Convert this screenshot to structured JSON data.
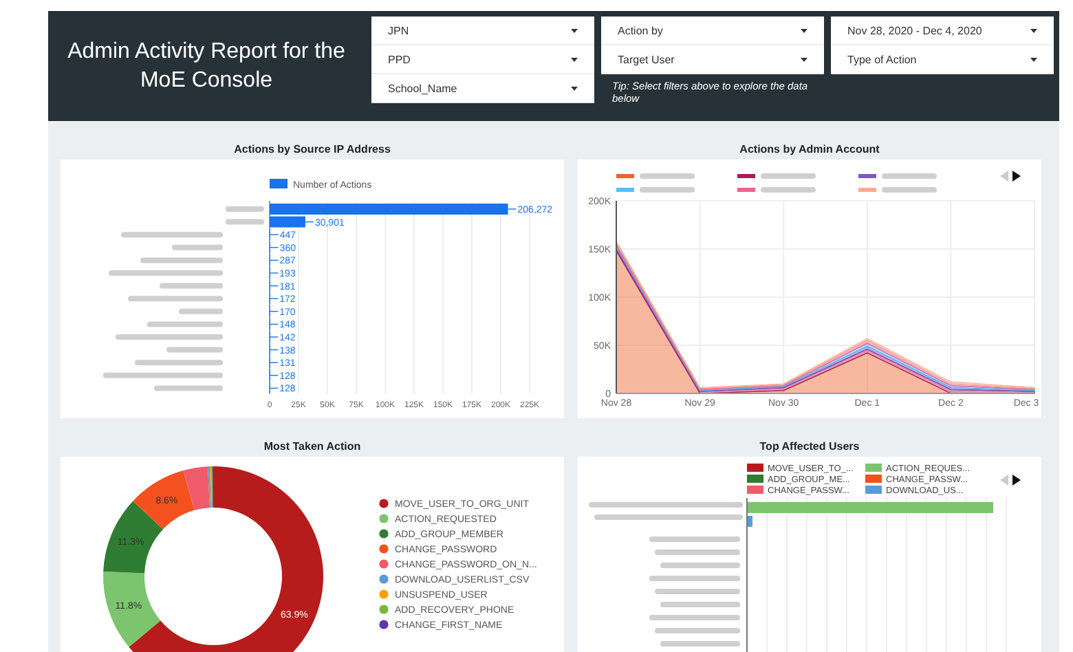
{
  "header": {
    "title": "Admin Activity Report for the MoE Console",
    "filter_groups": [
      {
        "filters": [
          "JPN",
          "PPD",
          "School_Name"
        ]
      },
      {
        "filters": [
          "Action by",
          "Target User"
        ],
        "tip": "Tip: Select filters above to explore the data below"
      },
      {
        "filters": [
          "Nov 28, 2020 - Dec 4, 2020",
          "Type of Action"
        ]
      }
    ]
  },
  "ip_chart": {
    "title": "Actions by Source IP Address",
    "chart_data": {
      "type": "bar",
      "orientation": "horizontal",
      "grid": true,
      "legend": true,
      "series": [
        {
          "name": "Number of Actions",
          "color": "#1a73e8",
          "values": [
            206272,
            30901,
            447,
            360,
            287,
            193,
            181,
            172,
            170,
            148,
            142,
            138,
            131,
            128,
            128
          ]
        }
      ],
      "value_labels": [
        "206,272",
        "30,901",
        "447",
        "360",
        "287",
        "193",
        "181",
        "172",
        "170",
        "148",
        "142",
        "138",
        "131",
        "128",
        "128"
      ],
      "xticks": [
        {
          "value": 0,
          "label": "0"
        },
        {
          "value": 25000,
          "label": "25K"
        },
        {
          "value": 50000,
          "label": "50K"
        },
        {
          "value": 75000,
          "label": "75K"
        },
        {
          "value": 100000,
          "label": "100K"
        },
        {
          "value": 125000,
          "label": "125K"
        },
        {
          "value": 150000,
          "label": "150K"
        },
        {
          "value": 175000,
          "label": "175K"
        },
        {
          "value": 200000,
          "label": "200K"
        },
        {
          "value": 225000,
          "label": "225K"
        }
      ],
      "xlim": [
        0,
        225000
      ]
    }
  },
  "admin_chart": {
    "title": "Actions by Admin Account",
    "chart_data": {
      "type": "area",
      "stacked": true,
      "grid": true,
      "x": [
        "Nov 28",
        "Nov 29",
        "Nov 30",
        "Dec 1",
        "Dec 2",
        "Dec 3"
      ],
      "series": [
        {
          "color": "#f0622d",
          "values": [
            148000,
            0,
            3000,
            42000,
            0,
            0
          ]
        },
        {
          "color": "#b0195a",
          "values": [
            2000,
            2000,
            3000,
            4000,
            4000,
            2000
          ]
        },
        {
          "color": "#7e57c2",
          "values": [
            2000,
            1000,
            1000,
            3000,
            2000,
            1000
          ]
        },
        {
          "color": "#4fc3f7",
          "values": [
            2000,
            1000,
            1000,
            3000,
            2000,
            1000
          ]
        },
        {
          "color": "#f06292",
          "values": [
            2000,
            1000,
            1000,
            3000,
            2000,
            1000
          ]
        },
        {
          "color": "#ffab91",
          "values": [
            2000,
            1000,
            1000,
            2000,
            2000,
            1000
          ]
        }
      ],
      "ylim": [
        0,
        200000
      ],
      "yticks": [
        {
          "value": 0,
          "label": "0"
        },
        {
          "value": 50000,
          "label": "50K"
        },
        {
          "value": 100000,
          "label": "100K"
        },
        {
          "value": 150000,
          "label": "150K"
        },
        {
          "value": 200000,
          "label": "200K"
        }
      ]
    }
  },
  "action_chart": {
    "title": "Most Taken Action",
    "chart_data": {
      "type": "donut",
      "legend": true,
      "categories": [
        "MOVE_USER_TO_ORG_UNIT",
        "ACTION_REQUESTED",
        "ADD_GROUP_MEMBER",
        "CHANGE_PASSWORD",
        "CHANGE_PASSWORD_ON_N...",
        "DOWNLOAD_USERLIST_CSV",
        "UNSUSPEND_USER",
        "ADD_RECOVERY_PHONE",
        "CHANGE_FIRST_NAME"
      ],
      "series": [
        {
          "values": [
            63.9,
            11.8,
            11.3,
            8.6,
            3.6,
            0.3,
            0.2,
            0.2,
            0.1
          ],
          "colors": [
            "#b71c1c",
            "#7cc46e",
            "#2e7d32",
            "#f4511e",
            "#ef5b6b",
            "#5b9bd5",
            "#ffa000",
            "#7cb342",
            "#5e35b1"
          ]
        }
      ],
      "value_labels": [
        "63.9%",
        "11.8%",
        "11.3%",
        "8.6%",
        null,
        null,
        null,
        null,
        null
      ]
    }
  },
  "users_chart": {
    "title": "Top Affected Users",
    "legend": [
      {
        "label": "MOVE_USER_TO_...",
        "color": "#b71c1c"
      },
      {
        "label": "ACTION_REQUES...",
        "color": "#7cc46e"
      },
      {
        "label": "ADD_GROUP_ME...",
        "color": "#2e7d32"
      },
      {
        "label": "CHANGE_PASSW...",
        "color": "#f4511e"
      },
      {
        "label": "CHANGE_PASSW...",
        "color": "#ef5b6b"
      },
      {
        "label": "DOWNLOAD_US...",
        "color": "#5b9bd5"
      }
    ]
  }
}
